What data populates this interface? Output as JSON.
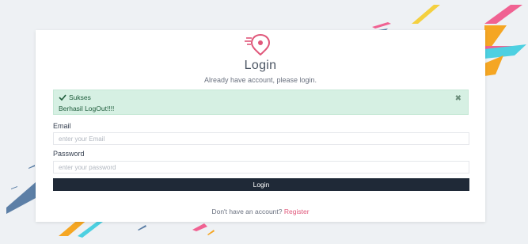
{
  "login": {
    "title": "Login",
    "subtitle": "Already have account, please login."
  },
  "alert": {
    "title": "Sukses",
    "message": "Berhasil LogOut!!!!",
    "close_icon": "close-icon",
    "check_icon": "check-icon"
  },
  "form": {
    "email_label": "Email",
    "email_placeholder": "enter your Email",
    "email_value": "",
    "password_label": "Password",
    "password_placeholder": "enter your password",
    "password_value": ""
  },
  "buttons": {
    "login_label": "Login"
  },
  "footer": {
    "prompt": "Don't have an account?",
    "register_label": "Register"
  },
  "colors": {
    "accent": "#e0577a",
    "button": "#1f2937",
    "alert_bg": "#d6f0e3",
    "stripe_pink": "#f06292",
    "stripe_yellow": "#f4d03f",
    "stripe_cyan": "#4dd0e1",
    "stripe_orange": "#f5a623",
    "stripe_blue": "#5c7fa6"
  },
  "icons": {
    "logo": "location-pin-logo-icon"
  }
}
